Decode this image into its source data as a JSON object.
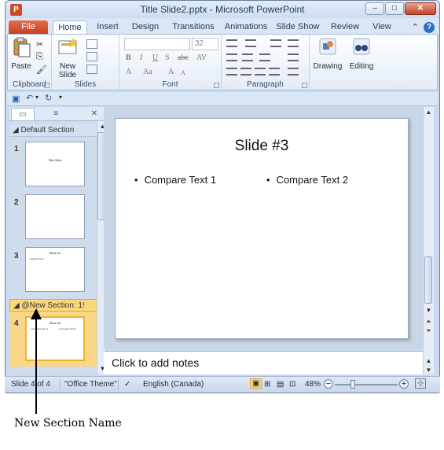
{
  "window": {
    "title": "Title Slide2.pptx - Microsoft PowerPoint",
    "app_icon": "P"
  },
  "ribbon_tabs": [
    "File",
    "Home",
    "Insert",
    "Design",
    "Transitions",
    "Animations",
    "Slide Show",
    "Review",
    "View"
  ],
  "ribbon": {
    "clipboard": {
      "paste": "Paste",
      "label": "Clipboard"
    },
    "slides": {
      "new_slide": "New Slide",
      "label": "Slides"
    },
    "font": {
      "size": "32",
      "label": "Font"
    },
    "paragraph": {
      "label": "Paragraph"
    },
    "drawing": {
      "label": "Drawing"
    },
    "editing": {
      "label": "Editing"
    }
  },
  "left_panel": {
    "default_section": "Default Section",
    "new_section": "@New Section: 1!",
    "slides": [
      {
        "num": "1",
        "title": "Title Slide"
      },
      {
        "num": "2",
        "title": ""
      },
      {
        "num": "3",
        "title": "Slide #1",
        "bullet": "• Sample Text"
      },
      {
        "num": "4",
        "title": "Slide #3",
        "bullet1": "• Compare Text 1",
        "bullet2": "• Compare Text 2"
      }
    ]
  },
  "slide": {
    "title": "Slide #3",
    "bullet1": "Compare Text 1",
    "bullet2": "Compare Text 2"
  },
  "notes": {
    "placeholder": "Click to add notes"
  },
  "status": {
    "slide_info": "Slide 4 of 4",
    "theme": "\"Office Theme\"",
    "language": "English (Canada)",
    "zoom": "48%"
  },
  "annotation": {
    "label": "New Section Name"
  }
}
